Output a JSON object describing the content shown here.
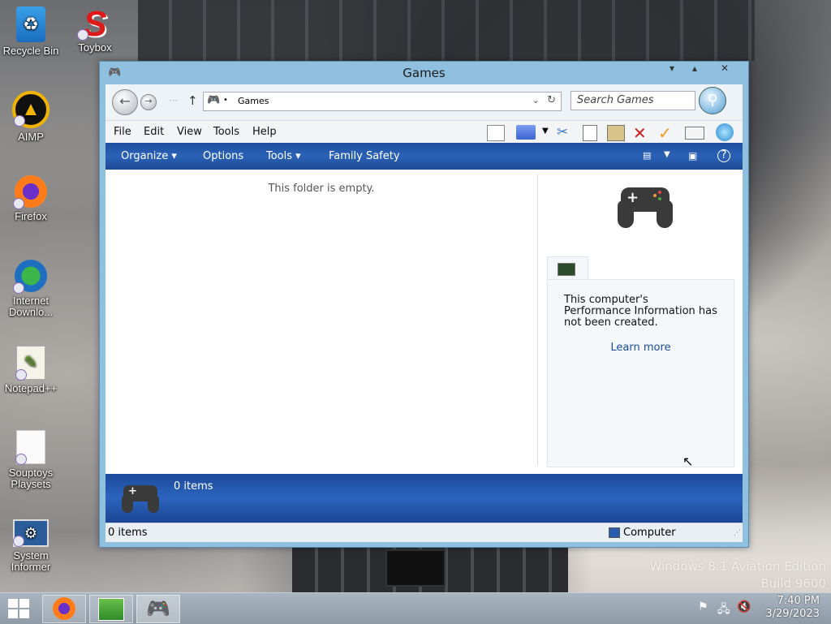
{
  "desktop": {
    "icons": [
      {
        "label": "Recycle Bin"
      },
      {
        "label": "Toybox"
      },
      {
        "label": "AIMP"
      },
      {
        "label": "Firefox"
      },
      {
        "label": "Internet Downlo..."
      },
      {
        "label": "Notepad++"
      },
      {
        "label": "Souptoys Playsets"
      },
      {
        "label": "System Informer"
      }
    ],
    "watermark": {
      "line1": "Windows 8.1 Aviation Edition",
      "line2": "Build 9600"
    }
  },
  "window": {
    "title": "Games",
    "address": {
      "path": "Games"
    },
    "search": {
      "placeholder": "Search Games"
    },
    "menu": [
      "File",
      "Edit",
      "View",
      "Tools",
      "Help"
    ],
    "command_bar": {
      "organize": "Organize ▾",
      "options": "Options",
      "tools": "Tools ▾",
      "family_safety": "Family Safety"
    },
    "content": {
      "empty_message": "This folder is empty."
    },
    "preview": {
      "performance_text": "This computer's Performance Information has not been created.",
      "learn_more": "Learn more"
    },
    "details": {
      "count": "0 items"
    },
    "status": {
      "left": "0 items",
      "right": "Computer"
    }
  },
  "taskbar": {
    "time": "7:40 PM",
    "date": "3/29/2023"
  },
  "colors": {
    "accent": "#2b62b7",
    "window_frame": "#8fc0e0"
  }
}
